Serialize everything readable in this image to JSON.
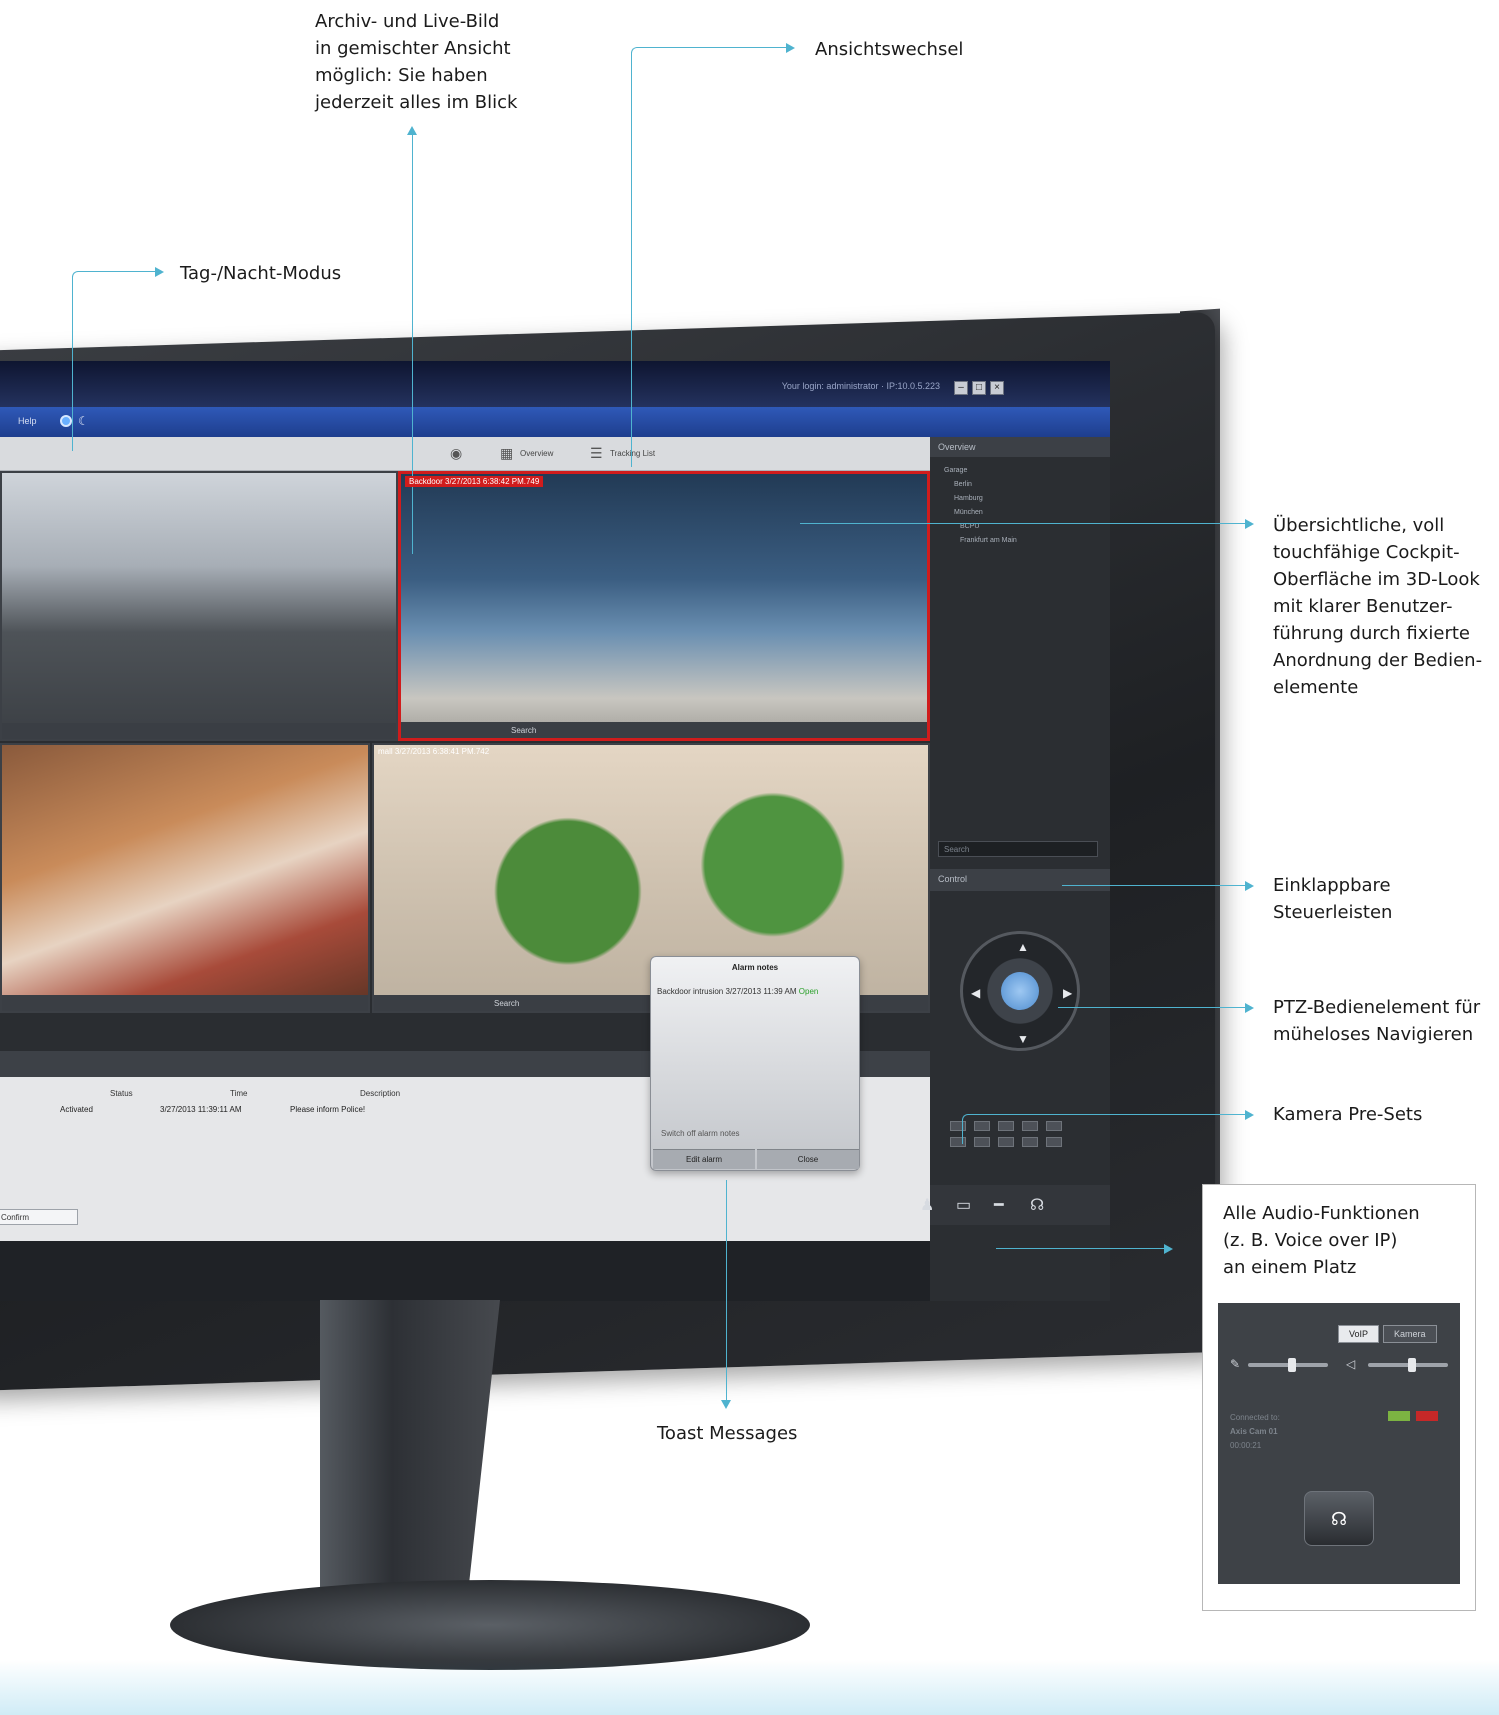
{
  "colors": {
    "accent": "#4fb3cf",
    "alarm_red": "#d01c1c",
    "titlebar_blue": "#2f59b8",
    "ok_green": "#2aa02a"
  },
  "callouts": {
    "archive_live": [
      "Archiv- und Live-Bild",
      "in gemischter Ansicht",
      "möglich: Sie haben",
      "jederzeit alles im Blick"
    ],
    "view_switch": "Ansichtswechsel",
    "day_night": "Tag-/Nacht-Modus",
    "cockpit": [
      "Übersichtliche, voll",
      "touchfähige Cockpit-",
      "Oberfläche im 3D-Look",
      "mit klarer Benutzer-",
      "führung durch fixierte",
      "Anordnung der Bedien-",
      "elemente"
    ],
    "collapsible": [
      "Einklappbare",
      "Steuerleisten"
    ],
    "ptz": [
      "PTZ-Bedienelement für",
      "müheloses Navigieren"
    ],
    "presets": "Kamera Pre-Sets",
    "audio": [
      "Alle Audio-Funktionen",
      "(z. B. Voice over IP)",
      "an einem Platz"
    ],
    "toast": "Toast Messages"
  },
  "app": {
    "title_ip": "Your login: administrator · IP:10.0.5.223",
    "menu_help": "Help",
    "icons": {
      "day": "sun-icon",
      "night": "moon-icon"
    },
    "viewbar": {
      "overview": "Overview",
      "tracking": "Tracking List"
    },
    "cameras": [
      {
        "timestamp": ""
      },
      {
        "timestamp": "Backdoor 3/27/2013 6:38:42 PM.749",
        "search": "Search"
      },
      {
        "timestamp": ""
      },
      {
        "timestamp": "mall 3/27/2013 6:38:41 PM.742",
        "search": "Search"
      }
    ],
    "alarm_table": {
      "headers": [
        "Status",
        "Time",
        "Description"
      ],
      "row": {
        "status": "Activated",
        "time": "3/27/2013 11:39:11 AM",
        "description": "Please inform Police!"
      },
      "confirm": "Confirm"
    },
    "toast": {
      "title": "Alarm notes",
      "name": "Backdoor intrusion",
      "time": "3/27/2013 11:39 AM",
      "state": "Open",
      "switch_off": "Switch off alarm notes",
      "edit": "Edit alarm",
      "close": "Close"
    },
    "sidepanel": {
      "overview": "Overview",
      "tree": [
        "Garage",
        "Berlin",
        "Hamburg",
        "München",
        "BCPU",
        "Frankfurt am Main"
      ],
      "search_placeholder": "Search",
      "control": "Control"
    }
  },
  "audio_panel": {
    "tabs": [
      "VoIP",
      "Kamera"
    ],
    "connected": "Connected to:",
    "device": "Axis Cam 01",
    "duration": "00:00:21"
  }
}
